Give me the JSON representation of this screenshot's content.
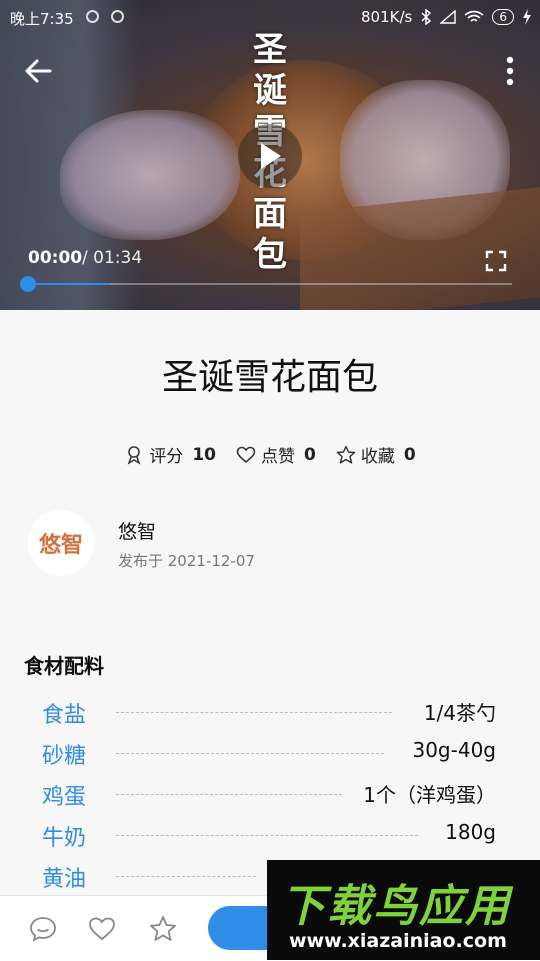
{
  "status_bar": {
    "time": "晚上7:35",
    "speed": "801K/s",
    "battery": "6"
  },
  "video": {
    "overlay_title": "圣诞雪花面包",
    "current_time": "00:00",
    "separator": " / ",
    "total_time": "01:34",
    "progress": 0.0
  },
  "recipe": {
    "title": "圣诞雪花面包",
    "stats": [
      {
        "label": "评分",
        "value": "10",
        "icon": "rating-icon"
      },
      {
        "label": "点赞",
        "value": "0",
        "icon": "heart-icon"
      },
      {
        "label": "收藏",
        "value": "0",
        "icon": "star-icon"
      }
    ]
  },
  "author": {
    "logo_text": "悠智",
    "name": "悠智",
    "published": "发布于 2021-12-07"
  },
  "ingredients": {
    "heading": "食材配料",
    "items": [
      {
        "name": "食盐",
        "amount": "1/4茶勺"
      },
      {
        "name": "砂糖",
        "amount": "30g-40g"
      },
      {
        "name": "鸡蛋",
        "amount": "1个（洋鸡蛋）"
      },
      {
        "name": "牛奶",
        "amount": "180g"
      },
      {
        "name": "黄油",
        "amount": ""
      }
    ]
  },
  "bottom_bar": {
    "icons": [
      "comment-icon",
      "like-icon",
      "favorite-icon"
    ]
  },
  "watermark": {
    "brand": "下载鸟应用",
    "url": "www.xiazainiao.com"
  },
  "colors": {
    "accent": "#2f8de8",
    "watermark_green": "#7ed23a"
  }
}
